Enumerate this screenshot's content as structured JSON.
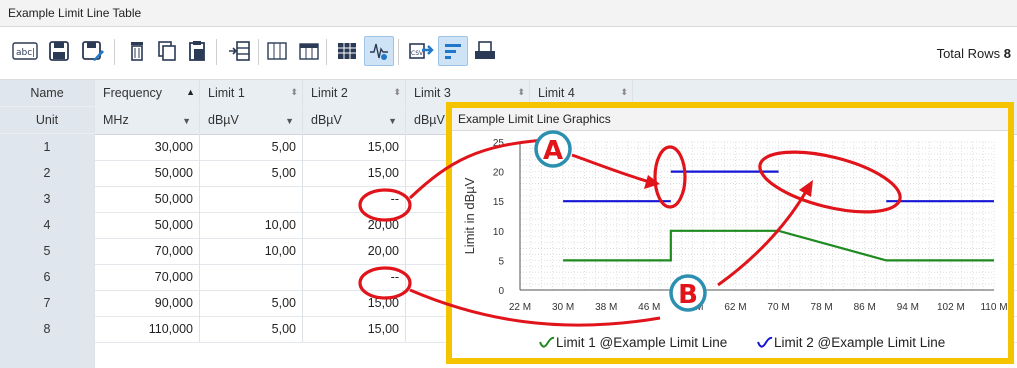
{
  "panel": {
    "title": "Example Limit Line Table"
  },
  "toolbar": {
    "icons": [
      "abc-icon",
      "save-icon",
      "save-as-icon",
      "delete-icon",
      "copy-icon",
      "paste-icon",
      "insert-row-icon",
      "columns-icon",
      "column-header-icon",
      "grid-icon",
      "graph-icon",
      "export-csv-icon",
      "sort-icon",
      "print-icon"
    ],
    "total_rows_label": "Total Rows",
    "total_rows_value": "8"
  },
  "table": {
    "header": [
      "Name",
      "Frequency",
      "Limit 1",
      "Limit 2",
      "Limit 3",
      "Limit 4"
    ],
    "units": [
      "Unit",
      "MHz",
      "dBµV",
      "dBµV",
      "dBµV"
    ],
    "rows": [
      {
        "name": "1",
        "freq": "30,000",
        "l1": "5,00",
        "l2": "15,00"
      },
      {
        "name": "2",
        "freq": "50,000",
        "l1": "5,00",
        "l2": "15,00"
      },
      {
        "name": "3",
        "freq": "50,000",
        "l1": "",
        "l2": "--"
      },
      {
        "name": "4",
        "freq": "50,000",
        "l1": "10,00",
        "l2": "20,00"
      },
      {
        "name": "5",
        "freq": "70,000",
        "l1": "10,00",
        "l2": "20,00"
      },
      {
        "name": "6",
        "freq": "70,000",
        "l1": "",
        "l2": "--"
      },
      {
        "name": "7",
        "freq": "90,000",
        "l1": "5,00",
        "l2": "15,00"
      },
      {
        "name": "8",
        "freq": "110,000",
        "l1": "5,00",
        "l2": "15,00"
      }
    ]
  },
  "graphic": {
    "title": "Example Limit Line Graphics",
    "ylabel": "Limit in dBµV",
    "xticks": [
      "22 M",
      "30 M",
      "38 M",
      "46 M",
      "54 M",
      "62 M",
      "70 M",
      "78 M",
      "86 M",
      "94 M",
      "102 M",
      "110 M"
    ],
    "yticks": [
      "0",
      "5",
      "10",
      "15",
      "20",
      "25"
    ],
    "legend": [
      "Limit 1 @Example Limit Line",
      "Limit 2 @Example Limit Line"
    ],
    "colors": {
      "limit1": "#1f8a1f",
      "limit2": "#1515d6",
      "callout": "#e0141a",
      "callout_ring": "#2b8fb0",
      "frame": "#f4c400"
    }
  },
  "chart_data": {
    "type": "line",
    "xlabel": "",
    "ylabel": "Limit in dBµV",
    "xlim": [
      22,
      110
    ],
    "ylim": [
      0,
      25
    ],
    "series": [
      {
        "name": "Limit 1 @Example Limit Line",
        "x": [
          30,
          50,
          50,
          70,
          90,
          110
        ],
        "y": [
          5,
          5,
          10,
          10,
          5,
          5
        ]
      },
      {
        "name": "Limit 2 @Example Limit Line",
        "segments": [
          [
            [
              30,
              15
            ],
            [
              50,
              15
            ]
          ],
          [
            [
              50,
              20
            ],
            [
              70,
              20
            ]
          ],
          [
            [
              90,
              15
            ],
            [
              110,
              15
            ]
          ]
        ]
      }
    ]
  },
  "annotations": {
    "a": "A",
    "b": "B"
  }
}
